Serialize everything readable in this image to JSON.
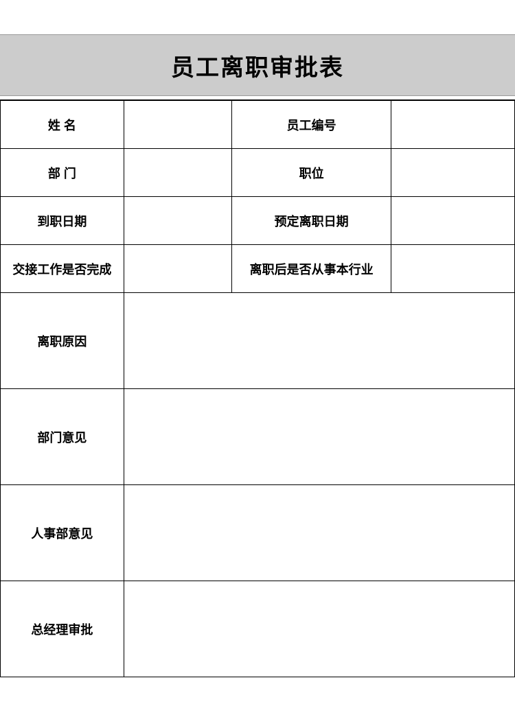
{
  "title": "员工离职审批表",
  "rows": {
    "r1": {
      "label1": "姓 名",
      "value1": "",
      "label2": "员工编号",
      "value2": ""
    },
    "r2": {
      "label1": "部 门",
      "value1": "",
      "label2": "职位",
      "value2": ""
    },
    "r3": {
      "label1": "到职日期",
      "value1": "",
      "label2": "预定离职日期",
      "value2": ""
    },
    "r4": {
      "label1": "交接工作是否完成",
      "value1": "",
      "label2": "离职后是否从事本行业",
      "value2": ""
    },
    "r5": {
      "label": "离职原因",
      "value": ""
    },
    "r6": {
      "label": "部门意见",
      "value": ""
    },
    "r7": {
      "label": "人事部意见",
      "value": ""
    },
    "r8": {
      "label": "总经理审批",
      "value": ""
    }
  }
}
